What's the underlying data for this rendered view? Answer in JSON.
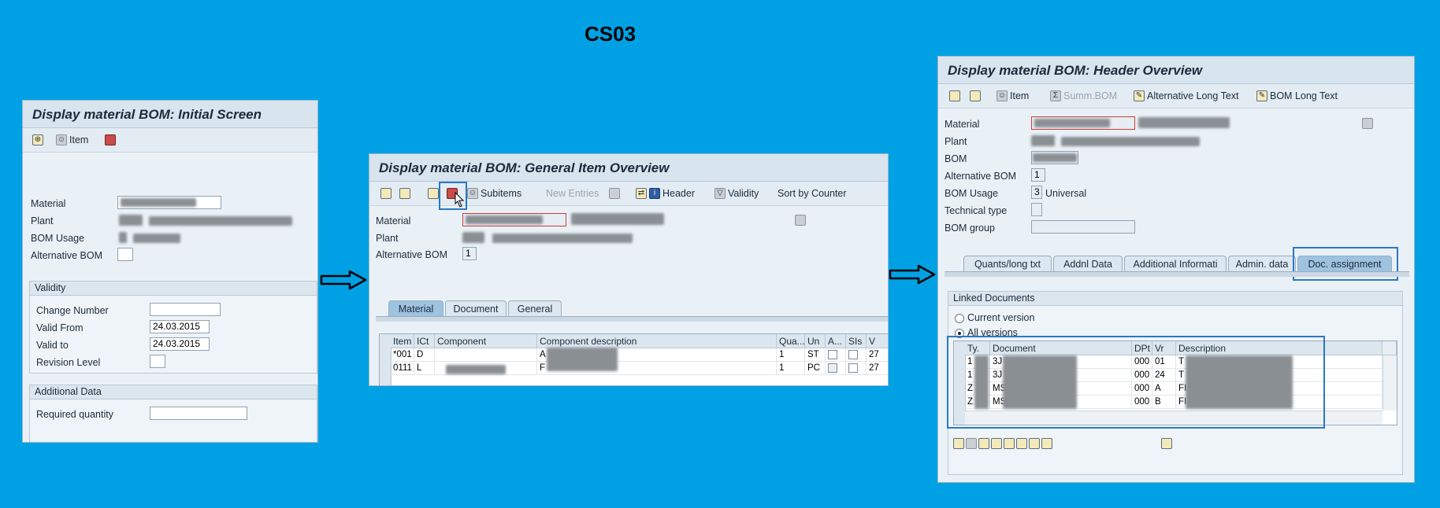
{
  "heading": "CS03",
  "screen1": {
    "title": "Display material BOM: Initial Screen",
    "toolbar": {
      "item_label": "Item"
    },
    "fields": {
      "material": "Material",
      "plant": "Plant",
      "bom_usage": "BOM Usage",
      "alternative_bom": "Alternative BOM"
    },
    "validity": {
      "header": "Validity",
      "change_number": "Change Number",
      "valid_from": "Valid From",
      "valid_from_value": "24.03.2015",
      "valid_to": "Valid to",
      "valid_to_value": "24.03.2015",
      "revision_level": "Revision Level"
    },
    "additional": {
      "header": "Additional Data",
      "required_quantity": "Required quantity"
    }
  },
  "screen2": {
    "title": "Display material BOM: General Item Overview",
    "toolbar": {
      "subitems": "Subitems",
      "new_entries": "New Entries",
      "header": "Header",
      "validity": "Validity",
      "sort_by_counter": "Sort by Counter"
    },
    "fields": {
      "material": "Material",
      "plant": "Plant",
      "alternative_bom": "Alternative BOM",
      "alternative_bom_value": "1"
    },
    "tabs": [
      "Material",
      "Document",
      "General"
    ],
    "grid": {
      "columns": [
        "Item",
        "ICt",
        "Component",
        "Component description",
        "Qua...",
        "Un",
        "A...",
        "SIs",
        "V"
      ],
      "rows": [
        {
          "item": "*001",
          "ict": "D",
          "desc_start": "A",
          "qty": "1",
          "unit": "ST",
          "v": "27"
        },
        {
          "item": "0111",
          "ict": "L",
          "desc_start": "F",
          "qty": "1",
          "unit": "PC",
          "v": "27"
        }
      ]
    }
  },
  "screen3": {
    "title": "Display material BOM: Header Overview",
    "toolbar": {
      "item": "Item",
      "summ_bom": "Summ.BOM",
      "alt_long_text": "Alternative Long Text",
      "bom_long_text": "BOM Long Text"
    },
    "fields": {
      "material": "Material",
      "plant": "Plant",
      "bom": "BOM",
      "alternative_bom": "Alternative BOM",
      "alternative_bom_value": "1",
      "bom_usage": "BOM Usage",
      "bom_usage_value": "3",
      "bom_usage_text": "Universal",
      "technical_type": "Technical type",
      "bom_group": "BOM group"
    },
    "tabs": [
      "Quants/long txt",
      "Addnl Data",
      "Additional Informati",
      "Admin. data",
      "Doc. assignment"
    ],
    "linked": {
      "header": "Linked Documents",
      "current_version": "Current version",
      "all_versions": "All versions",
      "columns": [
        "Ty.",
        "Document",
        "DPt",
        "Vr",
        "Description"
      ],
      "rows": [
        {
          "ty": "1",
          "doc": "3J",
          "dpt": "000",
          "vr": "01",
          "desc": "T"
        },
        {
          "ty": "1",
          "doc": "3J",
          "dpt": "000",
          "vr": "24",
          "desc": "T"
        },
        {
          "ty": "Z",
          "doc": "MS",
          "dpt": "000",
          "vr": "A",
          "desc": "FI"
        },
        {
          "ty": "Z",
          "doc": "MS",
          "dpt": "000",
          "vr": "B",
          "desc": "FI"
        }
      ]
    }
  }
}
